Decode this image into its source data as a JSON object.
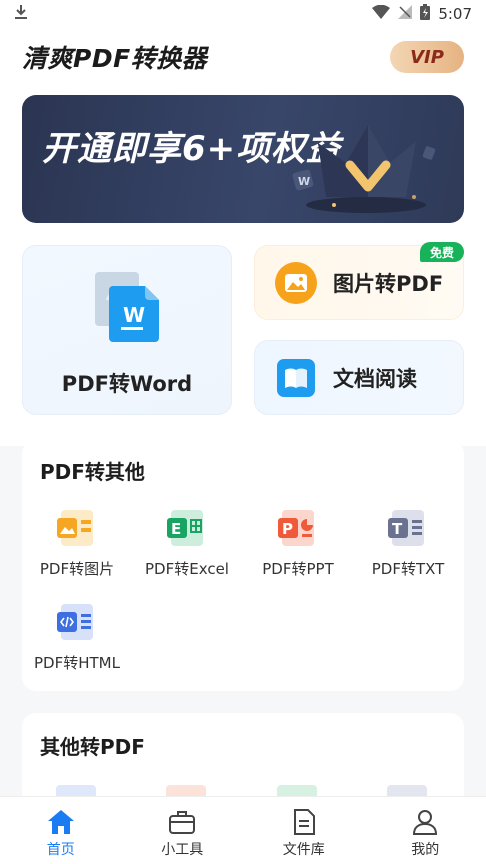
{
  "status_bar": {
    "time": "5:07"
  },
  "header": {
    "title": "清爽PDF转换器",
    "vip_label": "VIP"
  },
  "banner": {
    "text": "开通即享6+项权益"
  },
  "feature_cards": {
    "pdf_to_word": {
      "label": "PDF转Word"
    },
    "image_to_pdf": {
      "label": "图片转PDF",
      "badge": "免费"
    },
    "doc_reader": {
      "label": "文档阅读"
    }
  },
  "pdf_to_other": {
    "title": "PDF转其他",
    "tools": [
      {
        "label": "PDF转图片",
        "icon": "image-file-icon",
        "color": "#f5a623"
      },
      {
        "label": "PDF转Excel",
        "icon": "excel-file-icon",
        "color": "#19a463"
      },
      {
        "label": "PDF转PPT",
        "icon": "ppt-file-icon",
        "color": "#ee5a3a"
      },
      {
        "label": "PDF转TXT",
        "icon": "txt-file-icon",
        "color": "#6b7290"
      },
      {
        "label": "PDF转HTML",
        "icon": "html-file-icon",
        "color": "#3d6fe0"
      }
    ]
  },
  "other_to_pdf": {
    "title": "其他转PDF"
  },
  "tab_bar": {
    "tabs": [
      {
        "label": "首页",
        "icon": "home-icon",
        "active": true
      },
      {
        "label": "小工具",
        "icon": "toolbox-icon",
        "active": false
      },
      {
        "label": "文件库",
        "icon": "document-icon",
        "active": false
      },
      {
        "label": "我的",
        "icon": "user-icon",
        "active": false
      }
    ]
  },
  "colors": {
    "accent": "#1a7cf2",
    "banner_bg": "#2f3a58",
    "free_badge": "#17b259"
  }
}
